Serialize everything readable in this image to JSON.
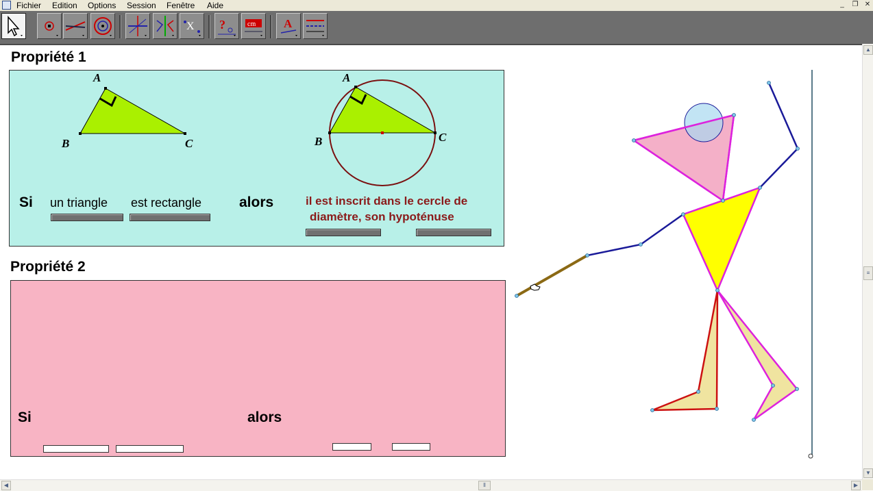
{
  "menu": {
    "items": [
      "Fichier",
      "Edition",
      "Options",
      "Session",
      "Fenêtre",
      "Aide"
    ]
  },
  "window_controls": [
    "minimize-icon",
    "restore-icon",
    "close-icon"
  ],
  "toolbar": {
    "tools": [
      {
        "name": "pointer-tool",
        "icon": "arrow-pointer-icon",
        "active": true
      },
      {
        "name": "point-tool",
        "icon": "point-icon"
      },
      {
        "name": "line-tool",
        "icon": "line-icon"
      },
      {
        "name": "curve-tool",
        "icon": "circle-icon"
      },
      {
        "name": "construction-tool",
        "icon": "perpendicular-icon"
      },
      {
        "name": "transformation-tool",
        "icon": "symmetry-icon"
      },
      {
        "name": "macro-tool",
        "icon": "macro-icon"
      },
      {
        "name": "property-tool",
        "icon": "question-icon"
      },
      {
        "name": "measure-tool",
        "icon": "measure-cm-icon"
      },
      {
        "name": "display-tool",
        "icon": "label-a-icon"
      },
      {
        "name": "drawing-tool",
        "icon": "attributes-icon"
      }
    ]
  },
  "prop1": {
    "title": "Propriété 1",
    "bg_color": "#b8f0e8",
    "left_figure": {
      "labels": {
        "a": "A",
        "b": "B",
        "c": "C"
      }
    },
    "right_figure": {
      "labels": {
        "a": "A",
        "b": "B",
        "c": "C"
      }
    },
    "si": "Si",
    "phrase1": "un triangle",
    "phrase2": "est rectangle",
    "alors": "alors",
    "conclusion_line1": "il est inscrit dans le cercle de",
    "conclusion_line2": "diamètre, son hypoténuse"
  },
  "prop2": {
    "title": "Propriété 2",
    "bg_color": "#f8b4c4",
    "si": "Si",
    "alors": "alors"
  },
  "colors": {
    "triangle_fill": "#aaf000",
    "circle": "#7a1010",
    "head_fill": "#f4b0c8",
    "body_fill": "#ffff00",
    "legs_fill": "#f0e4a0",
    "limbs": "#1a1a99",
    "magenta": "#dd22dd",
    "stick": "#8b6914"
  }
}
